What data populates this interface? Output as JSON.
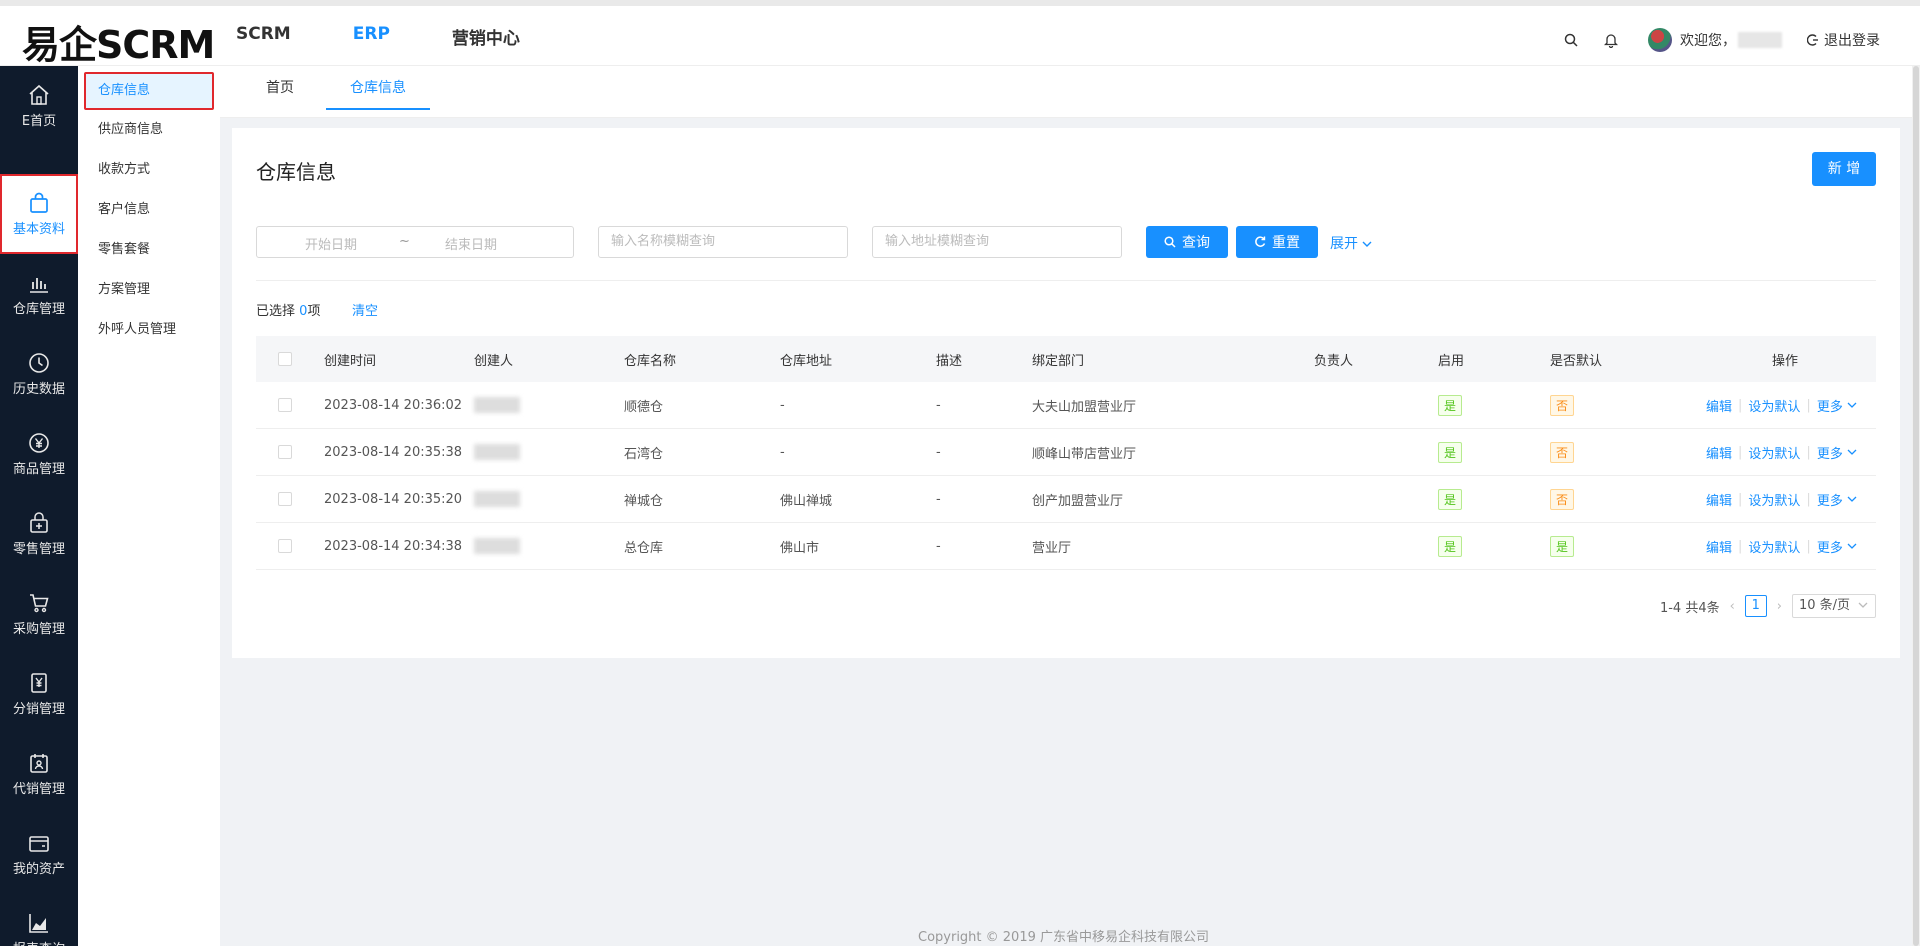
{
  "header": {
    "logo": "易企SCRM",
    "nav": [
      "SCRM",
      "ERP",
      "营销中心"
    ],
    "active_nav": "ERP",
    "welcome": "欢迎您，",
    "logout": "退出登录"
  },
  "sidebar": {
    "items": [
      {
        "label": "E首页",
        "icon": "home-icon"
      },
      {
        "label": "基本资料",
        "icon": "bag-icon"
      },
      {
        "label": "仓库管理",
        "icon": "bar-chart-icon"
      },
      {
        "label": "历史数据",
        "icon": "clock-icon"
      },
      {
        "label": "商品管理",
        "icon": "yen-circle-icon"
      },
      {
        "label": "零售管理",
        "icon": "retail-icon"
      },
      {
        "label": "采购管理",
        "icon": "cart-icon"
      },
      {
        "label": "分销管理",
        "icon": "yen-doc-icon"
      },
      {
        "label": "代销管理",
        "icon": "calendar-user-icon"
      },
      {
        "label": "我的资产",
        "icon": "wallet-icon"
      },
      {
        "label": "报表查询",
        "icon": "area-chart-icon"
      }
    ]
  },
  "submenu": {
    "items": [
      "仓库信息",
      "供应商信息",
      "收款方式",
      "客户信息",
      "零售套餐",
      "方案管理",
      "外呼人员管理"
    ]
  },
  "tabs": [
    "首页",
    "仓库信息"
  ],
  "page": {
    "title": "仓库信息",
    "new_button": "新 增",
    "start_date_placeholder": "开始日期",
    "date_sep": "~",
    "end_date_placeholder": "结束日期",
    "name_placeholder": "输入名称模糊查询",
    "address_placeholder": "输入地址模糊查询",
    "query_button": "查询",
    "reset_button": "重置",
    "expand": "展开",
    "selected_prefix": "已选择",
    "selected_count": "0",
    "selected_suffix": "项",
    "clear": "清空"
  },
  "table": {
    "columns": [
      "创建时间",
      "创建人",
      "仓库名称",
      "仓库地址",
      "描述",
      "绑定部门",
      "负责人",
      "启用",
      "是否默认",
      "操作"
    ],
    "rows": [
      {
        "time": "2023-08-14 20:36:02",
        "name": "顺德仓",
        "address": "-",
        "desc": "-",
        "dept": "大夫山加盟营业厅",
        "enabled": "是",
        "default": "否"
      },
      {
        "time": "2023-08-14 20:35:38",
        "name": "石湾仓",
        "address": "-",
        "desc": "-",
        "dept": "顺峰山带店营业厅",
        "enabled": "是",
        "default": "否"
      },
      {
        "time": "2023-08-14 20:35:20",
        "name": "禅城仓",
        "address": "佛山禅城",
        "desc": "-",
        "dept": "创产加盟营业厅",
        "enabled": "是",
        "default": "否"
      },
      {
        "time": "2023-08-14 20:34:38",
        "name": "总仓库",
        "address": "佛山市",
        "desc": "-",
        "dept": "营业厅",
        "enabled": "是",
        "default": "是"
      }
    ],
    "ops": {
      "edit": "编辑",
      "set_default": "设为默认",
      "more": "更多"
    }
  },
  "pagination": {
    "summary": "1-4 共4条",
    "current": "1",
    "page_size": "10 条/页"
  },
  "footer": "Copyright © 2019 广东省中移易企科技有限公司",
  "colors": {
    "primary": "#1890ff",
    "sidebar": "#0f1b2c",
    "highlight": "#e0282d"
  }
}
